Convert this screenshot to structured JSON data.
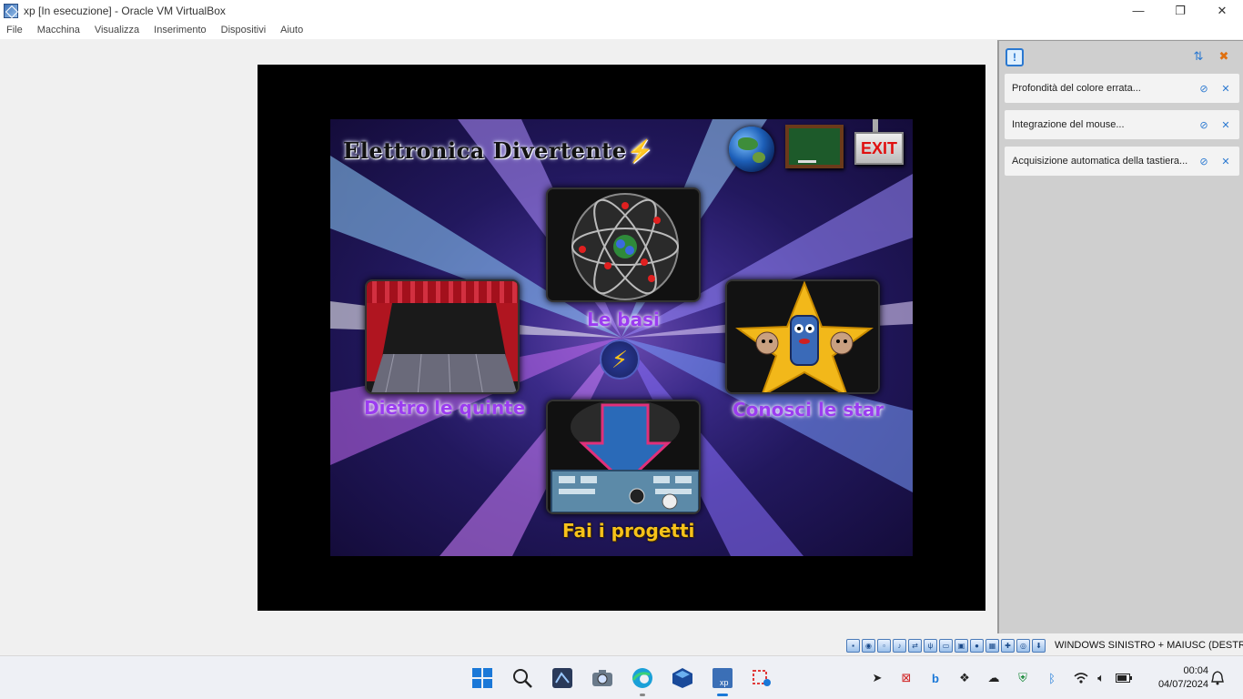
{
  "window": {
    "title": "xp [In esecuzione] - Oracle VM VirtualBox",
    "minimize": "—",
    "maximize": "❐",
    "close": "✕"
  },
  "menu": [
    "File",
    "Macchina",
    "Visualizza",
    "Inserimento",
    "Dispositivi",
    "Aiuto"
  ],
  "game": {
    "title": "Elettronica Divertente",
    "exit_label": "EXIT",
    "tiles": {
      "basics": "Le basi",
      "backstage": "Dietro le quinte",
      "stars": "Conosci le star",
      "projects": "Fai i progetti"
    }
  },
  "notifications": [
    "Profondità del colore errata...",
    "Integrazione del mouse...",
    "Acquisizione automatica della tastiera..."
  ],
  "statusbar": {
    "host_key": "WINDOWS SINISTRO + MAIUSC (DESTRA)"
  },
  "taskbar": {
    "time": "00:04",
    "date": "04/07/2024"
  },
  "colors": {
    "accent_purple": "#9b3cf0",
    "accent_yellow": "#f7c21a",
    "exit_red": "#e01010"
  }
}
